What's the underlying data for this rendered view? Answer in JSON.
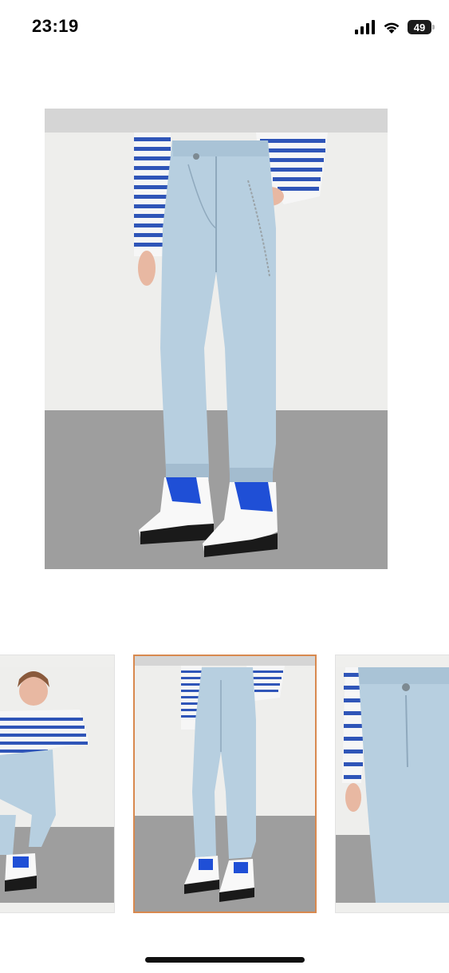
{
  "status_bar": {
    "time": "23:19",
    "battery_level": "49",
    "icons": [
      "cellular-signal-icon",
      "wifi-icon",
      "battery-icon"
    ]
  },
  "product_gallery": {
    "main_image": {
      "description_icon": "product-photo-light-wash-jogger-jeans",
      "selected_index": 1
    },
    "thumbnails": [
      {
        "icon": "model-seated-photo"
      },
      {
        "icon": "jeans-front-photo"
      },
      {
        "icon": "jeans-closeup-photo"
      }
    ],
    "selected_border_color": "#d8894f"
  },
  "colors": {
    "denim": "#b7cfe0",
    "stripe_blue": "#2f55b8",
    "sneaker_blue": "#1f4fd6",
    "floor_gray": "#9c9c9c",
    "wall": "#efefed"
  }
}
